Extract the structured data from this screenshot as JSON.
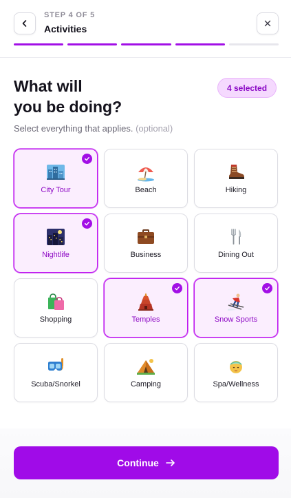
{
  "header": {
    "step": "STEP 4 OF 5",
    "title": "Activities",
    "progress": {
      "total_steps": 5,
      "completed_steps": 4
    }
  },
  "main": {
    "heading_line1": "What will",
    "heading_line2": "you be doing?",
    "selected_badge": "4 selected",
    "subtitle": "Select everything that applies.",
    "subtitle_optional": "(optional)",
    "activities": [
      {
        "label": "City Tour",
        "selected": true,
        "icon": "city-icon"
      },
      {
        "label": "Beach",
        "selected": false,
        "icon": "beach-umbrella-icon"
      },
      {
        "label": "Hiking",
        "selected": false,
        "icon": "hiking-boot-icon"
      },
      {
        "label": "Nightlife",
        "selected": true,
        "icon": "night-city-icon"
      },
      {
        "label": "Business",
        "selected": false,
        "icon": "briefcase-icon"
      },
      {
        "label": "Dining Out",
        "selected": false,
        "icon": "fork-knife-icon"
      },
      {
        "label": "Shopping",
        "selected": false,
        "icon": "shopping-bags-icon"
      },
      {
        "label": "Temples",
        "selected": true,
        "icon": "temple-icon"
      },
      {
        "label": "Snow Sports",
        "selected": true,
        "icon": "skier-icon"
      },
      {
        "label": "Scuba/Snorkel",
        "selected": false,
        "icon": "diving-mask-icon"
      },
      {
        "label": "Camping",
        "selected": false,
        "icon": "camping-tent-icon"
      },
      {
        "label": "Spa/Wellness",
        "selected": false,
        "icon": "spa-icon"
      }
    ]
  },
  "footer": {
    "continue_label": "Continue"
  },
  "colors": {
    "accent": "#a00be8",
    "selected_bg": "#fbeefe",
    "badge_bg": "#f5d9fe"
  }
}
